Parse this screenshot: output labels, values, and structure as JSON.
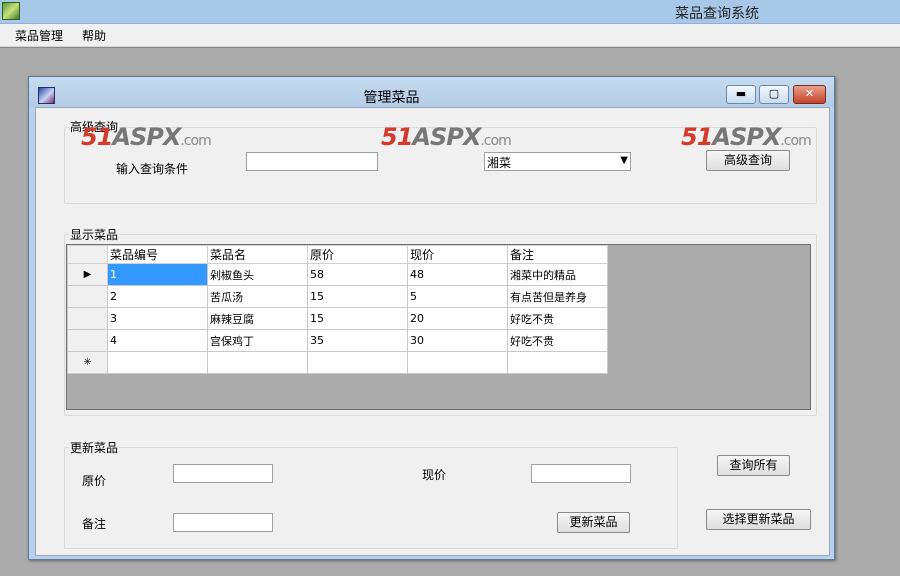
{
  "app": {
    "title": "菜品查询系统"
  },
  "menu": {
    "items": [
      "菜品管理",
      "帮助"
    ]
  },
  "child": {
    "title": "管理菜品"
  },
  "search_group": {
    "label": "高级查询",
    "condition_label": "输入查询条件",
    "condition_value": "",
    "category_selected": "湘菜",
    "button": "高级查询"
  },
  "watermark": {
    "brand1": "51",
    "brand2": "ASPX",
    "brand3": ".com"
  },
  "grid_group": {
    "label": "显示菜品",
    "columns": [
      "菜品编号",
      "菜品名",
      "原价",
      "现价",
      "备注"
    ],
    "rows": [
      [
        "1",
        "剁椒鱼头",
        "58",
        "48",
        "湘菜中的精品"
      ],
      [
        "2",
        "苦瓜汤",
        "15",
        "5",
        "有点苦但是养身"
      ],
      [
        "3",
        "麻辣豆腐",
        "15",
        "20",
        "好吃不贵"
      ],
      [
        "4",
        "宫保鸡丁",
        "35",
        "30",
        "好吃不贵"
      ]
    ],
    "current_row_marker": "▶",
    "new_row_marker": "✳"
  },
  "update_group": {
    "label": "更新菜品",
    "original_price_label": "原价",
    "original_price_value": "",
    "current_price_label": "现价",
    "current_price_value": "",
    "note_label": "备注",
    "note_value": "",
    "update_button": "更新菜品"
  },
  "side_buttons": {
    "query_all": "查询所有",
    "select_update": "选择更新菜品"
  },
  "window_controls": {
    "minimize": "▬",
    "maximize": "▢",
    "close": "✕"
  }
}
